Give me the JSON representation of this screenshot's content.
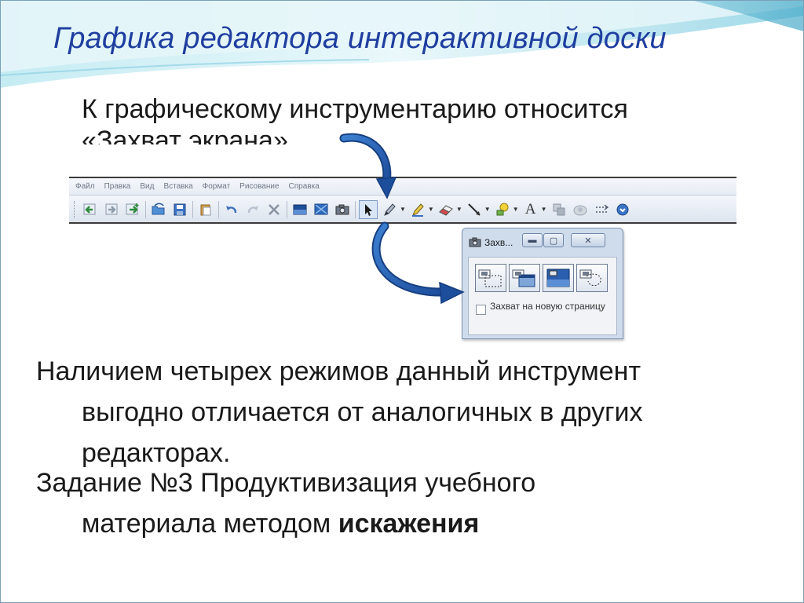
{
  "slide": {
    "title": "Графика редактора интерактивной доски",
    "intro": {
      "line1": "К  графическому инструментарию относится",
      "line2": "«Захват     экрана»"
    },
    "paragraph1": {
      "line1": "Наличием четырех режимов данный инструмент",
      "line2": "выгодно отличается от аналогичных в других",
      "line3": "редакторах."
    },
    "paragraph2": {
      "line1": "Задание №3 Продуктивизация учебного",
      "line2_plain": "материала методом ",
      "line2_bold": "искажения"
    }
  },
  "app": {
    "menu": [
      "Файл",
      "Правка",
      "Вид",
      "Вставка",
      "Формат",
      "Рисование",
      "Справка"
    ],
    "toolbar_icons": [
      "back-icon",
      "forward-icon",
      "add-page-icon",
      "open-icon",
      "save-icon",
      "paste-icon",
      "undo-icon",
      "redo-icon",
      "delete-icon",
      "screen-shade-icon",
      "display-icon",
      "capture-icon",
      "select-icon",
      "pen-icon",
      "highlighter-icon",
      "eraser-icon",
      "line-icon",
      "fill-icon",
      "text-icon",
      "shapes-icon",
      "recorder-icon",
      "more-icon",
      "next-icon"
    ]
  },
  "dialog": {
    "title": "Захв...",
    "checkbox_label": "Захват на новую страницу",
    "modes": [
      "area-capture-icon",
      "window-capture-icon",
      "full-screen-capture-icon",
      "freehand-capture-icon"
    ]
  },
  "colors": {
    "title": "#1f3ea0",
    "arrow": "#2a5fb0",
    "wave_light": "#d6f0f6",
    "wave_dark": "#7ecadf"
  }
}
